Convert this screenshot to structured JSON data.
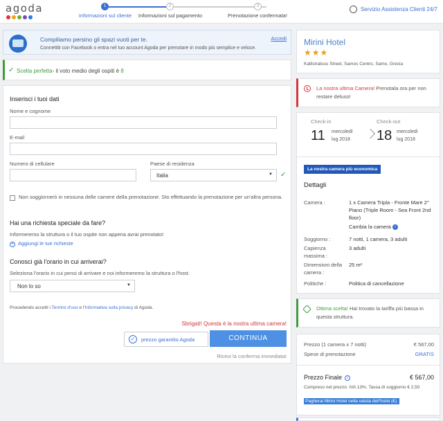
{
  "brand": {
    "logo_text": "agoda",
    "dot_colors": [
      "#e2342e",
      "#f1a21c",
      "#69b52c",
      "#7a4bbf",
      "#2d7bd6"
    ]
  },
  "steps": [
    {
      "number": "1",
      "label": "Informazioni sul cliente",
      "state": "active"
    },
    {
      "number": "2",
      "label": "Informazioni sul pagamento",
      "state": "pending"
    },
    {
      "number": "3",
      "label": "Prenotazione confermata!",
      "state": "pending"
    }
  ],
  "support": {
    "label": "Servizio Assistenza Clienti 24/7"
  },
  "facebook": {
    "title": "Compiliamo persino gli spazi vuoti per te.",
    "subtitle": "Connettiti con Facebook o entra nel tuo account Agoda per prenotare in modo più semplice e veloce.",
    "link": "Accedi"
  },
  "score": {
    "highlight": "Scelta perfetta",
    "text": "- il voto medio degli ospiti è",
    "value": "8"
  },
  "form": {
    "title": "Inserisci i tuoi dati",
    "name_label": "Nome e cognome",
    "name_value": "",
    "email_label": "E-mail",
    "email_value": "",
    "phone_label": "Numero di cellulare",
    "phone_value": "",
    "country_label": "Paese di residenza",
    "country_value": "Italia",
    "not_staying_text": "Non soggiornerò in nessuna delle camere della prenotazione. Sto effettuando la prenotazione per un'altra persona.",
    "special_title": "Hai una richiesta speciale da fare?",
    "special_sub": "Informeremo la struttura o il tuo ospite non appena avrai prenotato!",
    "special_link": "Aggiungi le tue richieste",
    "arrival_title": "Conosci già l'orario in cui arriverai?",
    "arrival_sub": "Seleziona l'orario in cui pensi di arrivare e noi informeremo la struttura o l'host.",
    "arrival_value": "Non lo so",
    "terms_prefix": "Procedendo accetti i",
    "terms_link": "Termini d'uso",
    "terms_mid": "e l'",
    "privacy_link": "Informativa sulla privacy",
    "terms_suffix": "di Agoda.",
    "hurry_text": "Sbrigati! Questa è la nostra ultima camera!",
    "guarantee_label": "prezzo garantito Agoda",
    "continue_label": "CONTINUA",
    "confirm_note": "Ricevi la conferma immediata!"
  },
  "hotel": {
    "name": "Mirini Hotel",
    "stars": "★★★",
    "address": "Kallistratous Street, Samos Centro, Samo, Grecia"
  },
  "last_room": {
    "highlight": "La nostra ultima Camera!",
    "text": "Prenotala ora per non restare deluso!"
  },
  "stay": {
    "checkin_label": "Check-in",
    "checkin_day": "11",
    "checkin_weekday": "mercoledì",
    "checkin_month": "lug 2018",
    "checkout_label": "Check-out",
    "checkout_day": "18",
    "checkout_weekday": "mercoledì",
    "checkout_month": "lug 2018",
    "cheapest_badge": "La nostra camera più economica",
    "details_title": "Dettagli",
    "room_label": "Camera :",
    "room_value": "1 x Camera Tripla - Fronte Mare 2° Piano (Triple Room - Sea Front 2nd floor)",
    "change_room": "Cambia la camera",
    "stay_label": "Soggiorno :",
    "stay_value": "7 notti, 1 camera, 3 adulti",
    "capacity_label": "Capienza massima :",
    "capacity_value": "3 adulti",
    "size_label": "Dimensioni della camera :",
    "size_value": "25 m²",
    "policy_label": "Politiche :",
    "policy_value": "Politica di cancellazione"
  },
  "deal": {
    "highlight": "Ottima scelta!",
    "text": "Hai trovato la tariffa più bassa in questa struttura."
  },
  "price": {
    "base_label": "Prezzo (1 camera x 7 notti)",
    "base_value": "€ 567,00",
    "fee_label": "Spese di prenotazione",
    "fee_value": "GRATIS",
    "final_label": "Prezzo Finale",
    "final_value": "€ 567,00",
    "tax_note": "Compreso nel prezzo: IVA 13%, Tassa di soggiorno € 2,50",
    "pay_note": "Pagherai Mirini Hotel nella valuta dell'hotel (€)."
  },
  "colors": {
    "accent": "#3b6fd4",
    "button": "#4e90e3",
    "success": "#3c9b3c",
    "danger": "#d3363a",
    "star": "#e3a21a"
  }
}
